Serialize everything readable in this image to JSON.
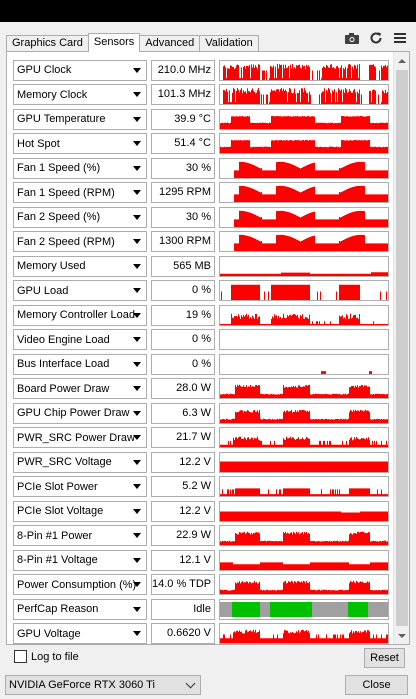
{
  "tabs": [
    {
      "label": "Graphics Card",
      "active": false
    },
    {
      "label": "Sensors",
      "active": true
    },
    {
      "label": "Advanced",
      "active": false
    },
    {
      "label": "Validation",
      "active": false
    }
  ],
  "toolbar_icons": [
    "camera-icon",
    "refresh-icon",
    "menu-icon"
  ],
  "colors": {
    "graph_red": "#ff0000",
    "perfcap_idle": "#00c000",
    "perfcap_gray": "#a0a0a0"
  },
  "sensors": [
    {
      "label": "GPU Clock",
      "value": "210.0 MHz",
      "pattern": "spiky-high"
    },
    {
      "label": "Memory Clock",
      "value": "101.3 MHz",
      "pattern": "spiky-high"
    },
    {
      "label": "GPU Temperature",
      "value": "39.9 °C",
      "pattern": "plateau-mid"
    },
    {
      "label": "Hot Spot",
      "value": "51.4 °C",
      "pattern": "plateau-mid"
    },
    {
      "label": "Fan 1 Speed (%)",
      "value": "30 %",
      "pattern": "wave"
    },
    {
      "label": "Fan 1 Speed (RPM)",
      "value": "1295 RPM",
      "pattern": "wave"
    },
    {
      "label": "Fan 2 Speed (%)",
      "value": "30 %",
      "pattern": "wave"
    },
    {
      "label": "Fan 2 Speed (RPM)",
      "value": "1300 RPM",
      "pattern": "wave"
    },
    {
      "label": "Memory Used",
      "value": "565 MB",
      "pattern": "low-flat"
    },
    {
      "label": "GPU Load",
      "value": "0 %",
      "pattern": "blocks"
    },
    {
      "label": "Memory Controller Load",
      "value": "19 %",
      "pattern": "blocks-low"
    },
    {
      "label": "Video Engine Load",
      "value": "0 %",
      "pattern": "empty"
    },
    {
      "label": "Bus Interface Load",
      "value": "0 %",
      "pattern": "bus"
    },
    {
      "label": "Board Power Draw",
      "value": "28.0 W",
      "pattern": "pulses"
    },
    {
      "label": "GPU Chip Power Draw",
      "value": "6.3 W",
      "pattern": "pulses"
    },
    {
      "label": "PWR_SRC Power Draw",
      "value": "21.7 W",
      "pattern": "noisy-low"
    },
    {
      "label": "PWR_SRC Voltage",
      "value": "12.2 V",
      "pattern": "full"
    },
    {
      "label": "PCIe Slot Power",
      "value": "5.2 W",
      "pattern": "pulses-low"
    },
    {
      "label": "PCIe Slot Voltage",
      "value": "12.2 V",
      "pattern": "full-dip"
    },
    {
      "label": "8-Pin #1 Power",
      "value": "22.9 W",
      "pattern": "pulses"
    },
    {
      "label": "8-Pin #1 Voltage",
      "value": "12.1 V",
      "pattern": "half-steps"
    },
    {
      "label": "Power Consumption (%)",
      "value": "14.0 % TDP",
      "pattern": "pulses"
    },
    {
      "label": "PerfCap Reason",
      "value": "Idle",
      "pattern": "perfcap"
    },
    {
      "label": "GPU Voltage",
      "value": "0.6620 V",
      "pattern": "spiky-mid"
    }
  ],
  "footer": {
    "log_label": "Log to file",
    "reset_label": "Reset",
    "gpu_name": "NVIDIA GeForce RTX 3060 Ti",
    "close_label": "Close"
  }
}
